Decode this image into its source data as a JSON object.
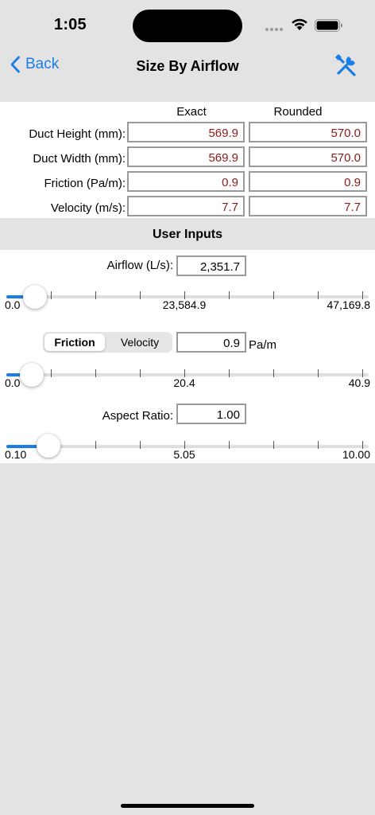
{
  "status": {
    "time": "1:05"
  },
  "nav": {
    "back_label": "Back",
    "title": "Size By Airflow"
  },
  "results": {
    "columns": [
      "Exact",
      "Rounded"
    ],
    "rows": [
      {
        "label": "Duct Height (mm):",
        "exact": "569.9",
        "rounded": "570.0"
      },
      {
        "label": "Duct Width (mm):",
        "exact": "569.9",
        "rounded": "570.0"
      },
      {
        "label": "Friction (Pa/m):",
        "exact": "0.9",
        "rounded": "0.9"
      },
      {
        "label": "Velocity (m/s):",
        "exact": "7.7",
        "rounded": "7.7"
      }
    ]
  },
  "section_title": "User Inputs",
  "airflow": {
    "label": "Airflow (L/s):",
    "value": "2,351.7",
    "slider_fraction": 0.05,
    "ticks": {
      "min": "0.0",
      "mid": "23,584.9",
      "max": "47,169.8"
    }
  },
  "friction_velocity": {
    "segments": [
      "Friction",
      "Velocity"
    ],
    "selected": "Friction",
    "value": "0.9",
    "unit": "Pa/m",
    "slider_fraction": 0.04,
    "ticks": {
      "min": "0.0",
      "mid": "20.4",
      "max": "40.9"
    }
  },
  "aspect_ratio": {
    "label": "Aspect Ratio:",
    "value": "1.00",
    "slider_fraction": 0.09,
    "ticks": {
      "min": "0.10",
      "mid": "5.05",
      "max": "10.00"
    }
  },
  "colors": {
    "accent": "#1a7ee6",
    "result_text": "#8b1a1a",
    "background": "#e3e3e3"
  }
}
